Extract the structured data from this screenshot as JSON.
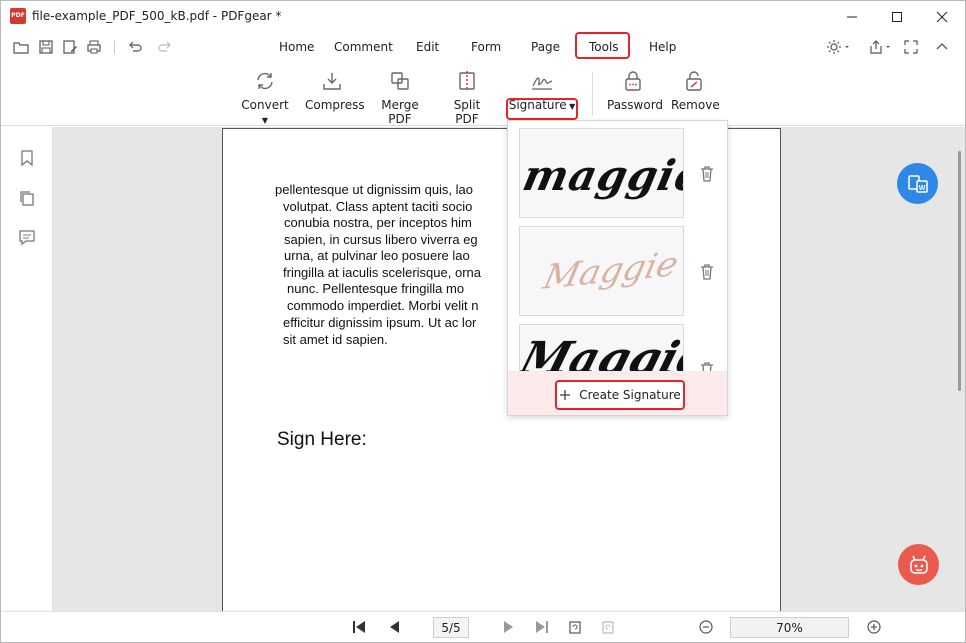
{
  "window": {
    "title": "file-example_PDF_500_kB.pdf - PDFgear *",
    "app_icon_text": "PDF"
  },
  "menu": {
    "items": [
      "Home",
      "Comment",
      "Edit",
      "Form",
      "Page",
      "Tools",
      "Help"
    ],
    "highlighted": "Tools"
  },
  "ribbon": {
    "convert": "Convert",
    "compress": "Compress",
    "merge": "Merge PDF",
    "split": "Split PDF",
    "signature": "Signature",
    "password": "Password",
    "remove": "Remove"
  },
  "document": {
    "lines": [
      "pellentesque ut dignissim quis, lao",
      "volutpat. Class aptent taciti socio",
      "conubia nostra, per inceptos him",
      "sapien, in cursus libero viverra eg",
      "urna, at pulvinar leo posuere lao",
      "fringilla at iaculis scelerisque, orna",
      "nunc. Pellentesque fringilla mo",
      "commodo imperdiet. Morbi velit n",
      "efficitur dignissim ipsum. Ut ac lor",
      "sit amet id sapien."
    ],
    "sign_here": "Sign Here:"
  },
  "signature_panel": {
    "signatures": [
      "maggie",
      "Maggie",
      "Maggie"
    ],
    "create_label": "Create Signature"
  },
  "bottom": {
    "page_current": "5/5",
    "zoom": "70%"
  },
  "colors": {
    "highlight": "#e0262b",
    "word_fab": "#2f88e6",
    "bot_fab": "#ea5a4f",
    "canvas": "#e6e6e6"
  }
}
